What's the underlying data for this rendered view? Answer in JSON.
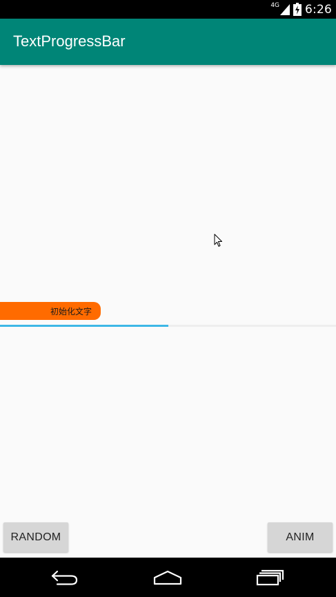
{
  "status_bar": {
    "network": "4G",
    "time": "6:26"
  },
  "app_bar": {
    "title": "TextProgressBar"
  },
  "progress": {
    "label": "初始化文字",
    "value_percent": 50,
    "fill_color": "#3db7e6",
    "label_bg_color": "#ff6b00"
  },
  "buttons": {
    "random": "RANDOM",
    "anim": "ANIM"
  },
  "colors": {
    "app_bar": "#008577",
    "background": "#fafafa",
    "button": "#d6d6d6"
  },
  "icons": {
    "signal": "cell-signal-icon",
    "battery": "battery-charging-icon",
    "cursor": "mouse-pointer-icon",
    "back": "back-icon",
    "home": "home-icon",
    "recents": "recents-icon"
  }
}
